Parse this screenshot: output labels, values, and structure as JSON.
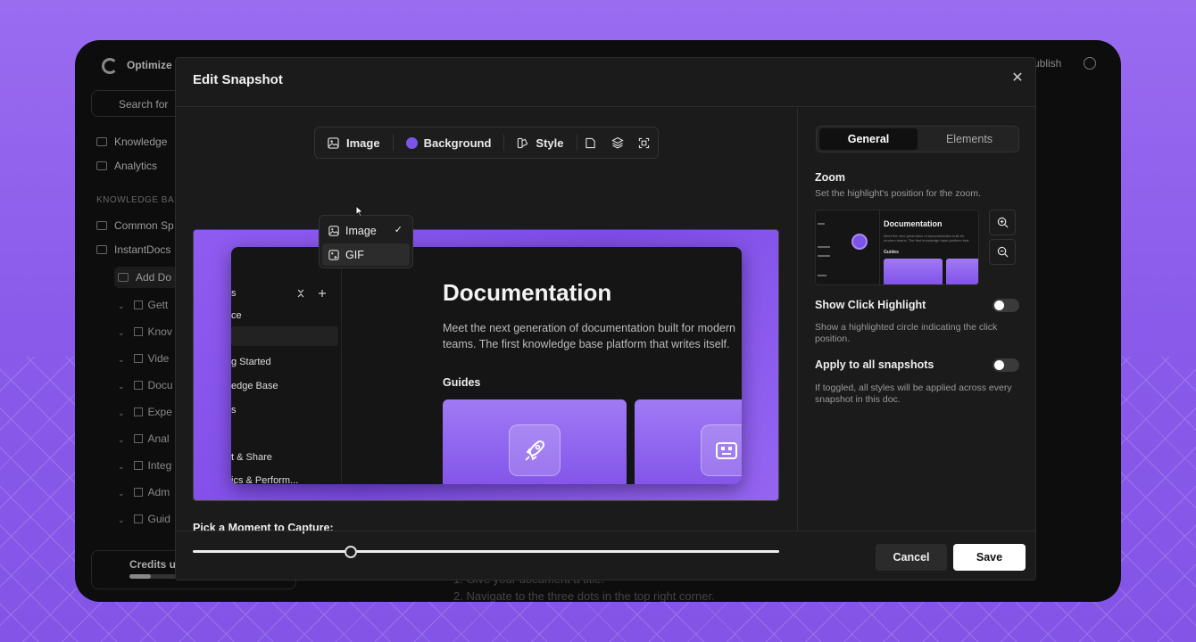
{
  "background_app": {
    "name": "Optimize",
    "search_placeholder": "Search for",
    "nav": [
      "Knowledge",
      "Analytics"
    ],
    "section_label": "KNOWLEDGE BAS",
    "spaces": [
      "Common Sp",
      "InstantDocs"
    ],
    "add_doc": "Add Do",
    "tree": [
      "Gett",
      "Knov",
      "Vide",
      "Docu",
      "Expe",
      "Anal",
      "Integ",
      "Adm",
      "Guid"
    ],
    "credits": "Credits u",
    "publish": "ublish",
    "bg_line_1": "1. Give your document a title.",
    "bg_line_2": "2. Navigate to the three dots in the top right corner."
  },
  "modal": {
    "title": "Edit Snapshot",
    "close_icon": "close-icon",
    "toolbar": {
      "image_label": "Image",
      "background_label": "Background",
      "background_color": "#7c55e8",
      "style_label": "Style"
    },
    "dropdown": {
      "items": [
        {
          "label": "Image",
          "selected": true
        },
        {
          "label": "GIF",
          "selected": false
        }
      ]
    },
    "preview": {
      "sidebar": [
        "s",
        "ce",
        "g Started",
        "edge Base",
        "s",
        "t & Share",
        "ics & Perform..."
      ],
      "title": "Documentation",
      "description": "Meet the next generation of documentation built for modern teams. The first knowledge base platform that writes itself.",
      "guides_label": "Guides",
      "accent": "#8b5cf6"
    },
    "capture": {
      "label": "Pick a Moment to Capture:",
      "position_fraction": 0.27
    },
    "panel": {
      "tabs": [
        {
          "label": "General",
          "active": true
        },
        {
          "label": "Elements",
          "active": false
        }
      ],
      "zoom": {
        "heading": "Zoom",
        "description": "Set the highlight's position for the zoom.",
        "preview_title": "Documentation",
        "preview_desc": "Meet the next generation of documentation built for modern teams. The first knowledge base platform that writes itself.",
        "preview_guides": "Guides"
      },
      "click_highlight": {
        "heading": "Show Click Highlight",
        "description": "Show a highlighted circle indicating the click position.",
        "enabled": false
      },
      "apply_all": {
        "heading": "Apply to all snapshots",
        "description": "If toggled, all styles will be applied across every snapshot in this doc.",
        "enabled": false
      }
    },
    "footer": {
      "cancel_label": "Cancel",
      "save_label": "Save"
    }
  }
}
